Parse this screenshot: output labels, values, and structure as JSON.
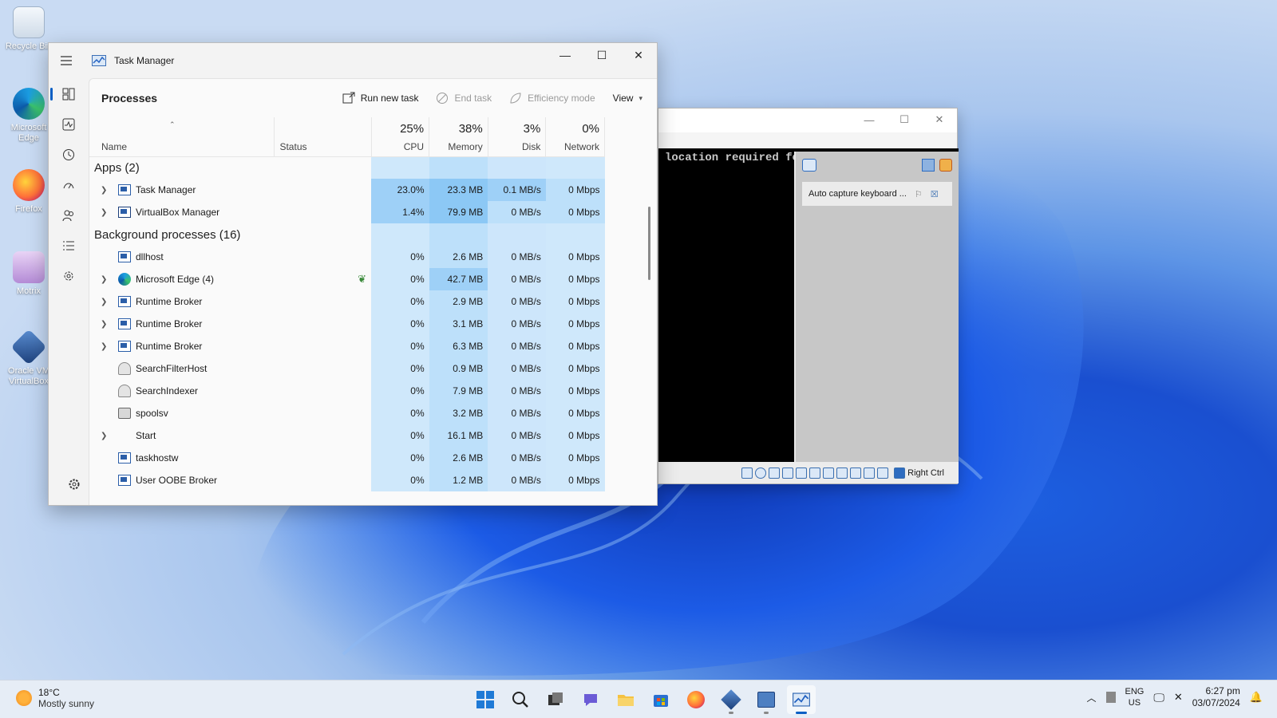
{
  "desktop": {
    "icons": [
      {
        "label": "Recycle Bin",
        "icon": "recycle-bin-icon"
      },
      {
        "label": "Microsoft Edge",
        "icon": "edge-icon"
      },
      {
        "label": "Firefox",
        "icon": "firefox-icon"
      },
      {
        "label": "Motrix",
        "icon": "motrix-icon"
      },
      {
        "label": "Oracle VM VirtualBox",
        "icon": "virtualbox-icon"
      }
    ]
  },
  "task_manager": {
    "title": "Task Manager",
    "page_title": "Processes",
    "commands": {
      "run_new_task": "Run new task",
      "end_task": "End task",
      "efficiency_mode": "Efficiency mode",
      "view": "View"
    },
    "columns": {
      "name": "Name",
      "status": "Status",
      "cpu": {
        "pct": "25%",
        "label": "CPU"
      },
      "memory": {
        "pct": "38%",
        "label": "Memory"
      },
      "disk": {
        "pct": "3%",
        "label": "Disk"
      },
      "network": {
        "pct": "0%",
        "label": "Network"
      }
    },
    "apps_group": "Apps (2)",
    "apps": [
      {
        "name": "Task Manager",
        "cpu": "23.0%",
        "memory": "23.3 MB",
        "disk": "0.1 MB/s",
        "network": "0 Mbps"
      },
      {
        "name": "VirtualBox Manager",
        "cpu": "1.4%",
        "memory": "79.9 MB",
        "disk": "0 MB/s",
        "network": "0 Mbps"
      }
    ],
    "background_group": "Background processes (16)",
    "background": [
      {
        "name": "dllhost",
        "cpu": "0%",
        "memory": "2.6 MB",
        "disk": "0 MB/s",
        "network": "0 Mbps"
      },
      {
        "name": "Microsoft Edge (4)",
        "cpu": "0%",
        "memory": "42.7 MB",
        "disk": "0 MB/s",
        "network": "0 Mbps"
      },
      {
        "name": "Runtime Broker",
        "cpu": "0%",
        "memory": "2.9 MB",
        "disk": "0 MB/s",
        "network": "0 Mbps"
      },
      {
        "name": "Runtime Broker",
        "cpu": "0%",
        "memory": "3.1 MB",
        "disk": "0 MB/s",
        "network": "0 Mbps"
      },
      {
        "name": "Runtime Broker",
        "cpu": "0%",
        "memory": "6.3 MB",
        "disk": "0 MB/s",
        "network": "0 Mbps"
      },
      {
        "name": "SearchFilterHost",
        "cpu": "0%",
        "memory": "0.9 MB",
        "disk": "0 MB/s",
        "network": "0 Mbps"
      },
      {
        "name": "SearchIndexer",
        "cpu": "0%",
        "memory": "7.9 MB",
        "disk": "0 MB/s",
        "network": "0 Mbps"
      },
      {
        "name": "spoolsv",
        "cpu": "0%",
        "memory": "3.2 MB",
        "disk": "0 MB/s",
        "network": "0 Mbps"
      },
      {
        "name": "Start",
        "cpu": "0%",
        "memory": "16.1 MB",
        "disk": "0 MB/s",
        "network": "0 Mbps"
      },
      {
        "name": "taskhostw",
        "cpu": "0%",
        "memory": "2.6 MB",
        "disk": "0 MB/s",
        "network": "0 Mbps"
      },
      {
        "name": "User OOBE Broker",
        "cpu": "0%",
        "memory": "1.2 MB",
        "disk": "0 MB/s",
        "network": "0 Mbps"
      }
    ]
  },
  "vm_window": {
    "console_text": "location required for the Windows. Wait",
    "notification": "Auto capture keyboard ...",
    "host_key": "Right Ctrl"
  },
  "taskbar": {
    "weather_temp": "18°C",
    "weather_desc": "Mostly sunny",
    "lang_top": "ENG",
    "lang_bottom": "US",
    "time": "6:27 pm",
    "date": "03/07/2024"
  },
  "colors": {
    "accent": "#0a5fc4",
    "cpu_highlight": "#9ed0f7",
    "heat_light": "#cfe8fb"
  }
}
